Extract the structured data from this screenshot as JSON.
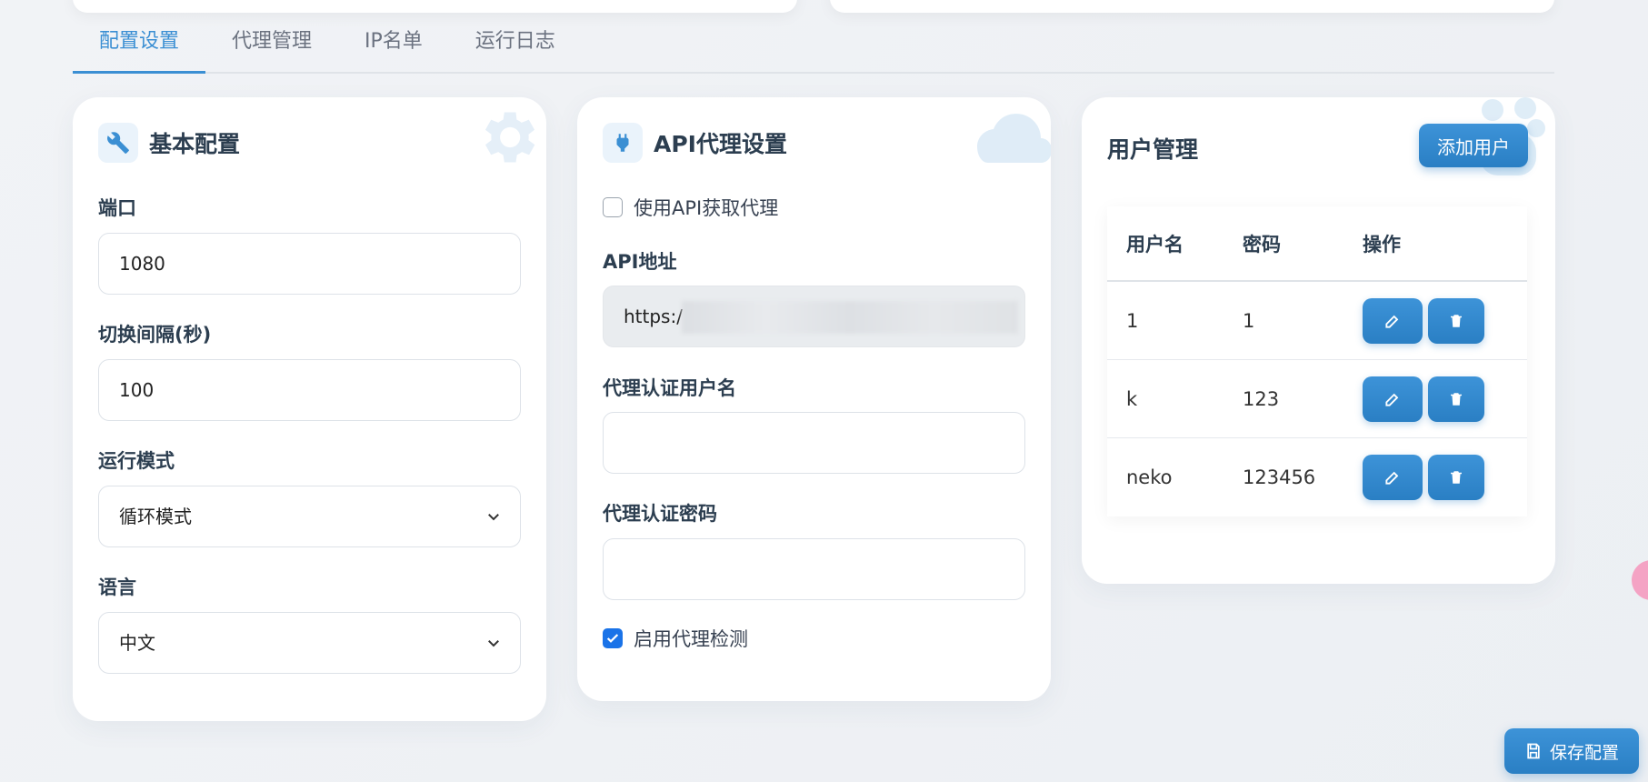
{
  "tabs": [
    {
      "label": "配置设置",
      "active": true
    },
    {
      "label": "代理管理",
      "active": false
    },
    {
      "label": "IP名单",
      "active": false
    },
    {
      "label": "运行日志",
      "active": false
    }
  ],
  "basic": {
    "title": "基本配置",
    "port_label": "端口",
    "port_value": "1080",
    "interval_label": "切换间隔(秒)",
    "interval_value": "100",
    "mode_label": "运行模式",
    "mode_value": "循环模式",
    "lang_label": "语言",
    "lang_value": "中文"
  },
  "api": {
    "title": "API代理设置",
    "use_api_label": "使用API获取代理",
    "use_api_checked": false,
    "url_label": "API地址",
    "url_value": "https:/",
    "auth_user_label": "代理认证用户名",
    "auth_user_value": "",
    "auth_pass_label": "代理认证密码",
    "auth_pass_value": "",
    "check_label": "启用代理检测",
    "check_checked": true
  },
  "users": {
    "title": "用户管理",
    "add_label": "添加用户",
    "columns": [
      "用户名",
      "密码",
      "操作"
    ],
    "rows": [
      {
        "username": "1",
        "password": "1"
      },
      {
        "username": "k",
        "password": "123"
      },
      {
        "username": "neko",
        "password": "123456"
      }
    ]
  },
  "save_label": "保存配置",
  "colors": {
    "accent": "#3b8fd3",
    "checkbox": "#1a73e8"
  }
}
